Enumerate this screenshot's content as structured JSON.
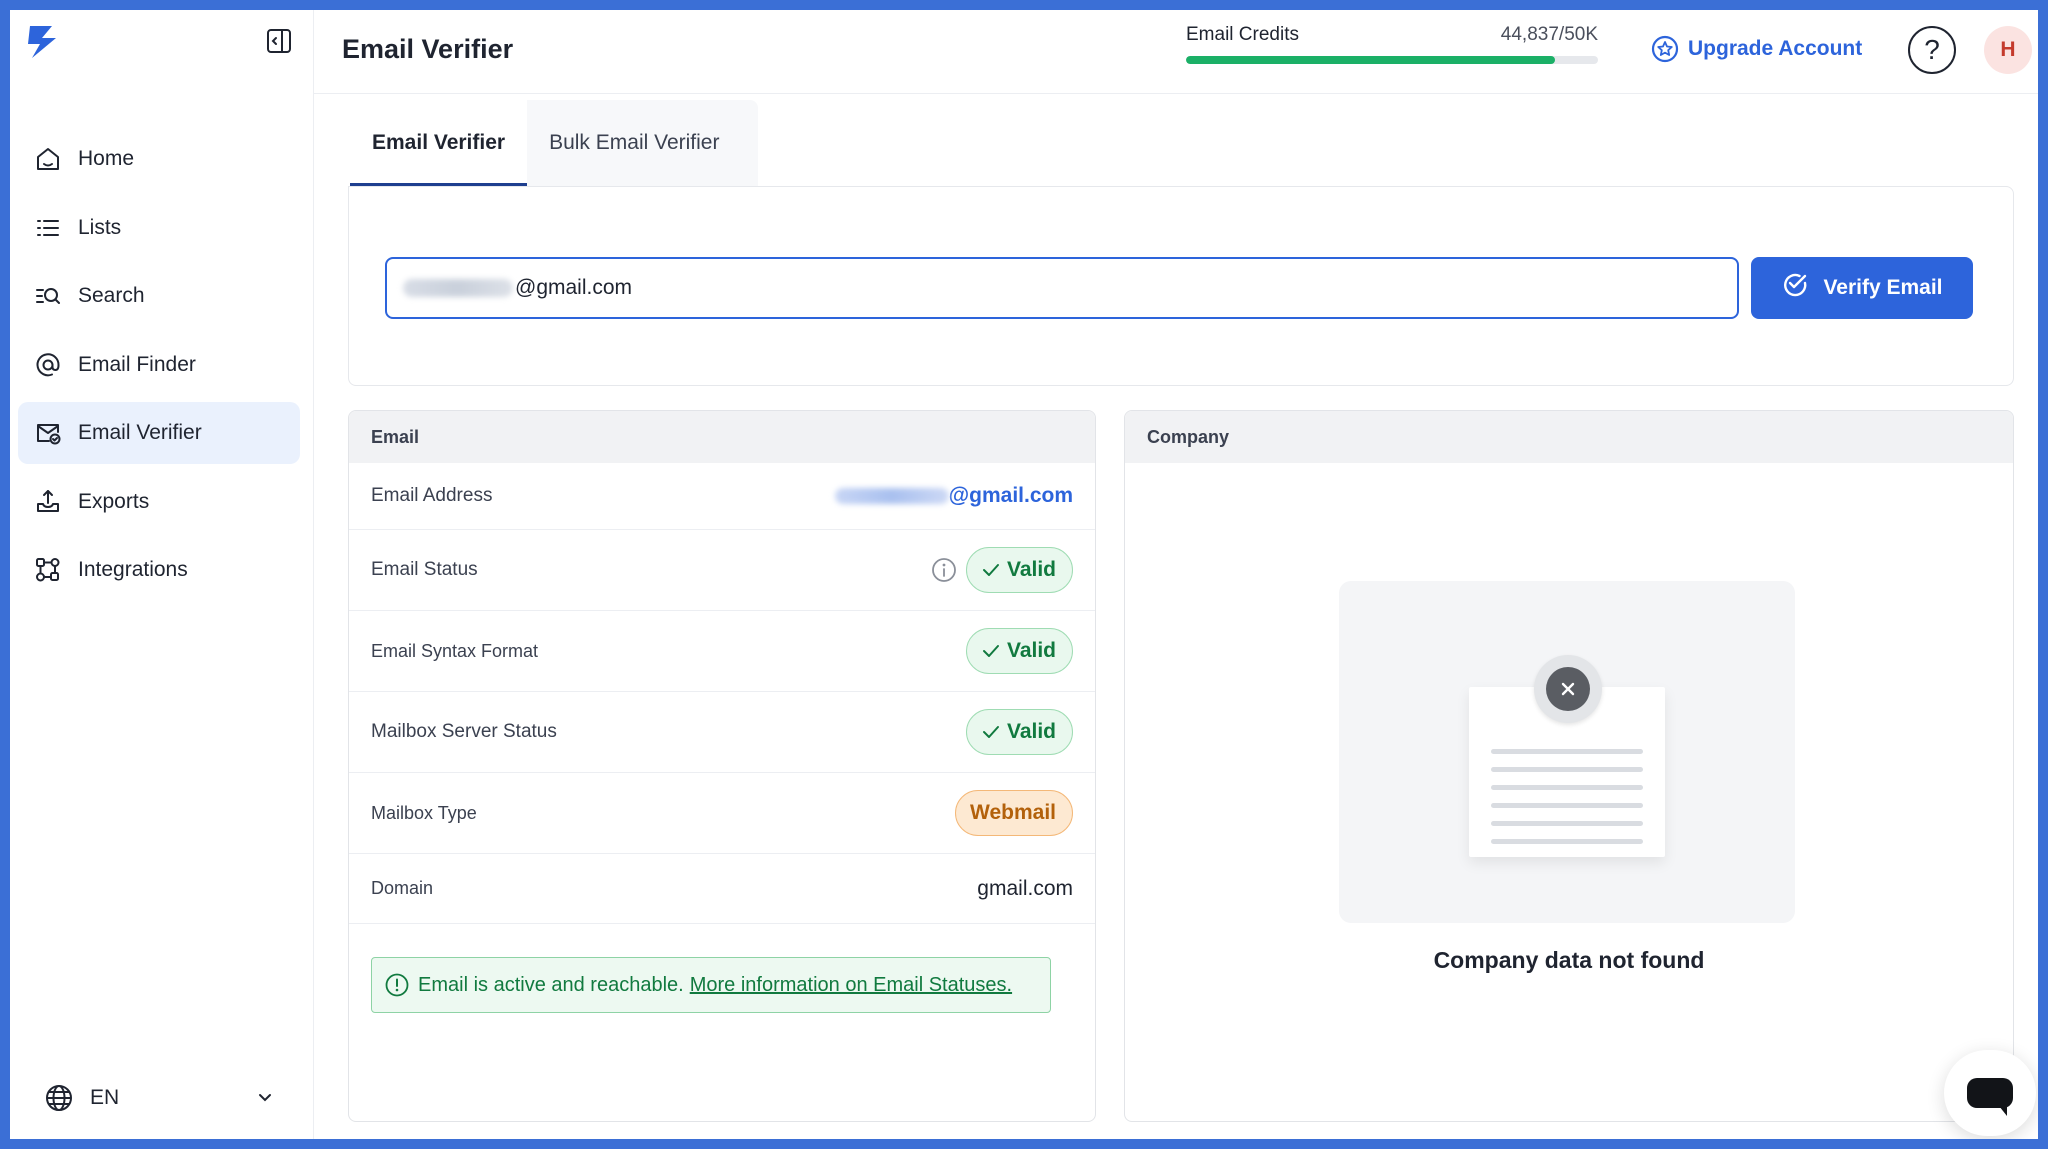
{
  "header": {
    "title": "Email Verifier",
    "credits_label": "Email Credits",
    "credits_value": "44,837/50K",
    "credits_fraction": 0.8967,
    "upgrade_label": "Upgrade Account",
    "help_label": "?",
    "avatar_initial": "H"
  },
  "sidebar": {
    "items": [
      {
        "label": "Home",
        "icon": "home-icon"
      },
      {
        "label": "Lists",
        "icon": "list-icon"
      },
      {
        "label": "Search",
        "icon": "search-icon"
      },
      {
        "label": "Email Finder",
        "icon": "at-sign-icon"
      },
      {
        "label": "Email Verifier",
        "icon": "mail-check-icon",
        "active": true
      },
      {
        "label": "Exports",
        "icon": "export-icon"
      },
      {
        "label": "Integrations",
        "icon": "integrations-icon"
      }
    ],
    "language": "EN"
  },
  "tabs": [
    {
      "label": "Email Verifier",
      "active": true
    },
    {
      "label": "Bulk Email Verifier",
      "active": false
    }
  ],
  "verify": {
    "input_value_visible": "@gmail.com",
    "button_label": "Verify Email"
  },
  "email_card": {
    "title": "Email",
    "rows": {
      "address": {
        "label": "Email Address",
        "value_visible": "@gmail.com"
      },
      "status": {
        "label": "Email Status",
        "badge": "Valid"
      },
      "syntax": {
        "label": "Email Syntax Format",
        "badge": "Valid"
      },
      "server": {
        "label": "Mailbox Server Status",
        "badge": "Valid"
      },
      "type": {
        "label": "Mailbox Type",
        "badge": "Webmail"
      },
      "domain": {
        "label": "Domain",
        "value": "gmail.com"
      }
    },
    "notice_text": "Email is active and reachable.",
    "notice_link": "More information on Email Statuses."
  },
  "company_card": {
    "title": "Company",
    "empty_text": "Company data not found"
  },
  "colors": {
    "accent": "#2d64db",
    "valid": "#117a3f",
    "webmail": "#b3610b",
    "credits_bar": "#1bb067"
  }
}
